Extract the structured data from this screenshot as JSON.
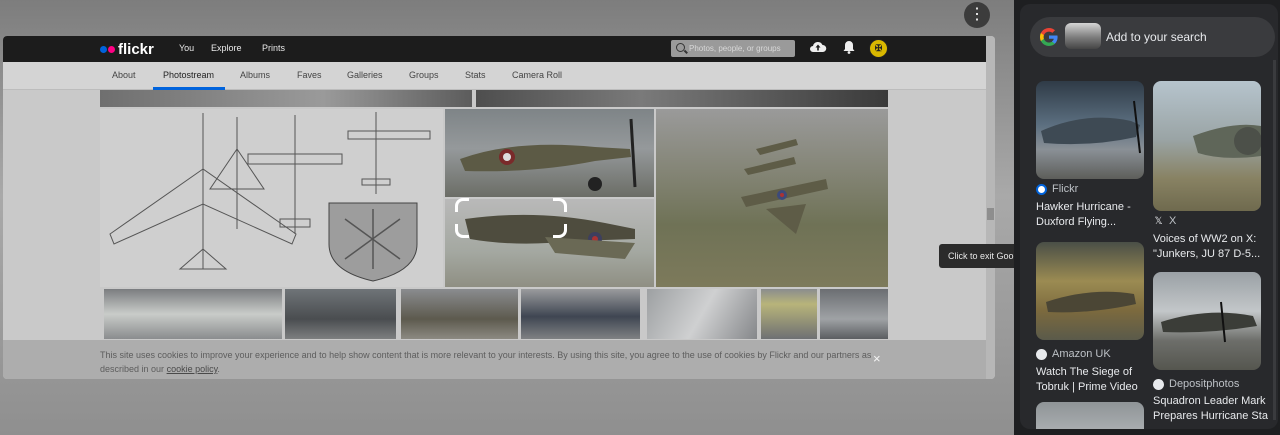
{
  "page": {
    "more_icon": "more-vert-icon",
    "tooltip_text": "Click to exit Goo"
  },
  "flickr": {
    "logo_text": "flickr",
    "nav": [
      "You",
      "Explore",
      "Prints"
    ],
    "search_placeholder": "Photos, people, or groups",
    "tabs": [
      "About",
      "Photostream",
      "Albums",
      "Faves",
      "Galleries",
      "Groups",
      "Stats",
      "Camera Roll"
    ],
    "active_tab": "Photostream",
    "brand_colors": {
      "blue": "#0063dc",
      "pink": "#ff0084"
    },
    "cookie_text": "This site uses cookies to improve your experience and to help show content that is more relevant to your interests. By using this site, you agree to the use of cookies by Flickr and our partners as described in our",
    "cookie_link": "cookie policy",
    "cookie_end": ".",
    "cookie_close": "×"
  },
  "lens": {
    "add_to_search": "Add to your search",
    "results": [
      {
        "source": "Flickr",
        "title": "Hawker Hurricane -\nDuxford Flying..."
      },
      {
        "source": "X",
        "title": "Voices of WW2 on X:\n\"Junkers, JU 87 D-5..."
      },
      {
        "source": "Amazon UK",
        "title": "Watch The Siege of\nTobruk | Prime Video"
      },
      {
        "source": "Depositphotos",
        "title": "Squadron Leader Mark\nPrepares Hurricane Sta"
      }
    ]
  }
}
